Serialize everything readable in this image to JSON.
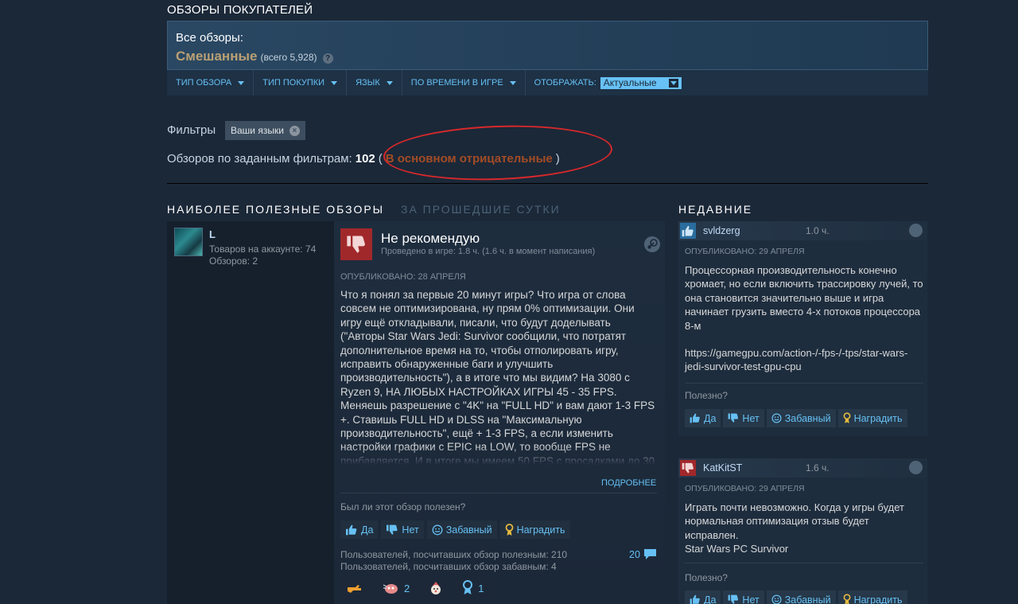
{
  "header": {
    "title": "ОБЗОРЫ ПОКУПАТЕЛЕЙ",
    "summary_label": "Все обзоры:",
    "summary_rating": "Смешанные",
    "summary_count": "(всего 5,928)",
    "help": "?"
  },
  "filter_bar": {
    "items": [
      {
        "label": "ТИП ОБЗОРА"
      },
      {
        "label": "ТИП ПОКУПКИ"
      },
      {
        "label": "ЯЗЫК"
      },
      {
        "label": "ПО ВРЕМЕНИ В ИГРЕ"
      }
    ],
    "display_label": "ОТОБРАЖАТЬ:",
    "display_value": "Актуальные"
  },
  "filters": {
    "label": "Фильтры",
    "chip": "Ваши языки",
    "count_prefix": "Обзоров по заданным фильтрам:",
    "count": "102",
    "open_paren": "(",
    "rating": "В основном отрицательные",
    "close_paren": ")"
  },
  "columns": {
    "main_title": "НАИБОЛЕЕ ПОЛЕЗНЫЕ ОБЗОРЫ",
    "main_subtitle": "ЗА ПРОШЕДШИЕ СУТКИ",
    "recent_title": "НЕДАВНИЕ"
  },
  "review": {
    "author": "L",
    "products": "Товаров на аккаунте: 74",
    "reviews": "Обзоров: 2",
    "verdict": "Не рекомендую",
    "playtime": "Проведено в игре: 1.8 ч. (1.6 ч. в момент написания)",
    "posted": "ОПУБЛИКОВАНО: 28 АПРЕЛЯ",
    "body": "Что я понял за первые 20 минут игры? Что игра от слова совсем не оптимизирована, ну прям 0% оптимизации. Они игру ещё откладывали, писали, что будут доделывать (\"Авторы Star Wars Jedi: Survivor сообщили, что потратят дополнительное время на то, чтобы отполировать игру, исправить обнаруженные баги и улучшить производительность\"), а в итоге что мы видим? На 3080 с Ryzen 9, НА ЛЮБЫХ НАСТРОЙКАХ ИГРЫ 45 - 35 FPS. Меняешь разрешение с \"4K\" на \"FULL HD\" и вам дают 1-3 FPS +. Ставишь FULL HD и DLSS на \"Максимальную производительность\", ещё + 1-3 FPS, а если изменить настройки графики с EPIC на LOW, то вообще FPS не прибавляется. И в итоге мы имеем 50 FPS с просадками до 30",
    "more": "ПОДРОБНЕЕ",
    "helpful_question": "Был ли этот обзор полезен?",
    "votes": {
      "yes": "Да",
      "no": "Нет",
      "funny": "Забавный",
      "award": "Наградить"
    },
    "helpful_stat": "Пользователей, посчитавших обзор полезным: 210",
    "funny_stat": "Пользователей, посчитавших обзор забавным: 4",
    "comments": "20",
    "awards": [
      {
        "icon": "pointing-hand-icon",
        "count": ""
      },
      {
        "icon": "cat-face-icon",
        "count": "2"
      },
      {
        "icon": "clown-face-icon",
        "count": ""
      },
      {
        "icon": "ribbon-award-icon",
        "count": "1"
      }
    ]
  },
  "recent": [
    {
      "name": "svldzerg",
      "hours": "1.0 ч.",
      "recommended": true,
      "posted": "ОПУБЛИКОВАНО: 29 АПРЕЛЯ",
      "body": "Процессорная производительность конечно хромает, но если включить трассировку лучей, то она становится значительно выше и игра начинает грузить вместо 4-х потоков процессора 8-м",
      "link": "https://gamegpu.com/action-/-fps-/-tps/star-wars-jedi-survivor-test-gpu-cpu",
      "helpful": "Полезно?",
      "votes": {
        "yes": "Да",
        "no": "Нет",
        "funny": "Забавный",
        "award": "Наградить"
      }
    },
    {
      "name": "KatKitST",
      "hours": "1.6 ч.",
      "recommended": false,
      "posted": "ОПУБЛИКОВАНО: 29 АПРЕЛЯ",
      "body": "Играть почти невозможно. Когда у игры будет нормальная оптимизация отзыв будет исправлен.",
      "body2": "Star Wars PC Survivor",
      "helpful": "Полезно?",
      "votes": {
        "yes": "Да",
        "no": "Нет",
        "funny": "Забавный",
        "award": "Наградить"
      }
    }
  ],
  "colors": {
    "background": "#1b2838",
    "mixed": "#b9a074",
    "negative": "#a34c25",
    "link": "#66c0f4",
    "thumb_down": "#a0282a",
    "thumb_up": "#2a6d9e",
    "annotation": "#d8282b"
  }
}
